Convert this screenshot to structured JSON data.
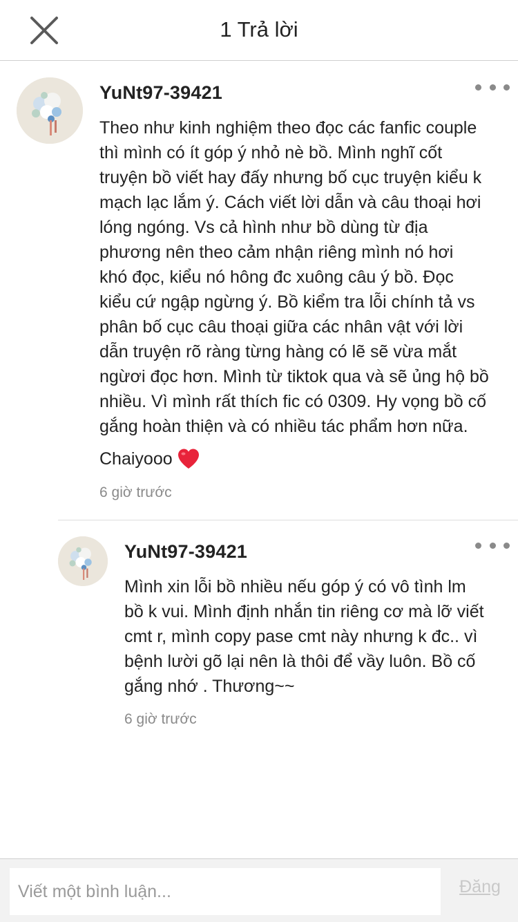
{
  "header": {
    "title": "1 Trả lời",
    "close_icon": "close-icon"
  },
  "comment": {
    "username": "YuNt97-39421",
    "lines": [
      "Theo như kinh nghiệm theo đọc các fanfic couple",
      "thì mình có ít góp ý nhỏ nè bồ. Mình nghĩ cốt",
      "truyện bồ viết hay đấy nhưng bố cục truyện kiểu k",
      "mạch lạc lắm ý. Cách viết lời dẫn và câu thoại hơi",
      "lóng ngóng. Vs cả hình như bồ dùng từ địa",
      "phương nên theo cảm nhận riêng mình nó hơi",
      "khó đọc, kiểu nó hông đc xuông câu ý bồ. Đọc",
      "kiểu cứ ngập ngừng ý. Bồ kiểm tra lỗi chính tả vs",
      "phân bố cục câu thoại giữa các nhân vật với lời",
      "dẫn truyện rõ ràng từng hàng có lẽ sẽ vừa mắt",
      "ngừơi đọc hơn. Mình từ tiktok qua và sẽ ủng hộ bồ",
      "nhiều. Vì mình rất thích fic có 0309. Hy vọng bồ cố",
      "gắng hoàn thiện và có nhiều tác phẩm hơn nữa."
    ],
    "closing": "Chaiyooo",
    "closing_emoji": "❤️",
    "time": "6 giờ trước",
    "more_icon": "more-options-icon"
  },
  "reply": {
    "username": "YuNt97-39421",
    "lines": [
      "Mình xin lỗi bồ nhiều nếu góp ý có vô tình lm",
      "bồ k vui. Mình định nhắn tin riêng cơ mà lỡ viết",
      "cmt r, mình copy pase cmt này nhưng k đc.. vì",
      "bệnh lười gõ lại nên là thôi để vầy luôn. Bồ cố",
      "gắng nhớ . Thương~~"
    ],
    "time": "6 giờ trước",
    "more_icon": "more-options-icon"
  },
  "composer": {
    "placeholder": "Viết một bình luận...",
    "post_label": "Đăng"
  },
  "colors": {
    "text": "#222222",
    "muted": "#8a8a8a",
    "disabled": "#c9c9c9",
    "divider": "#dddddd",
    "heart": "#e8233a"
  }
}
